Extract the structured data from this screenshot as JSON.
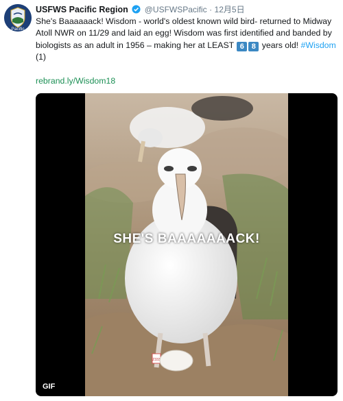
{
  "tweet": {
    "display_name": "USFWS Pacific Region",
    "handle": "@USFWSPacific",
    "separator": "·",
    "date": "12月5日",
    "text_part1": "She's Baaaaaack! Wisdom - world's oldest known wild bird-  returned to Midway Atoll NWR on 11/29 and laid an egg! Wisdom was first identified and banded by biologists as an adult in 1956 – making her at LEAST ",
    "key1": "6",
    "key2": "8",
    "text_part2": " years old! ",
    "hashtag": "#Wisdom",
    "text_part3": " (1)",
    "link": "rebrand.ly/Wisdom18"
  },
  "avatar": {
    "text": "Pacific",
    "icon": "usfws-logo"
  },
  "media": {
    "caption": "SHE'S BAAAAAAACK!",
    "badge": "GIF",
    "band_label": "Z333"
  },
  "colors": {
    "text": "#14171a",
    "muted": "#657786",
    "link": "#1b8f54",
    "hashtag": "#1da1f2",
    "verified": "#1da1f2",
    "media_bg": "#000000"
  }
}
